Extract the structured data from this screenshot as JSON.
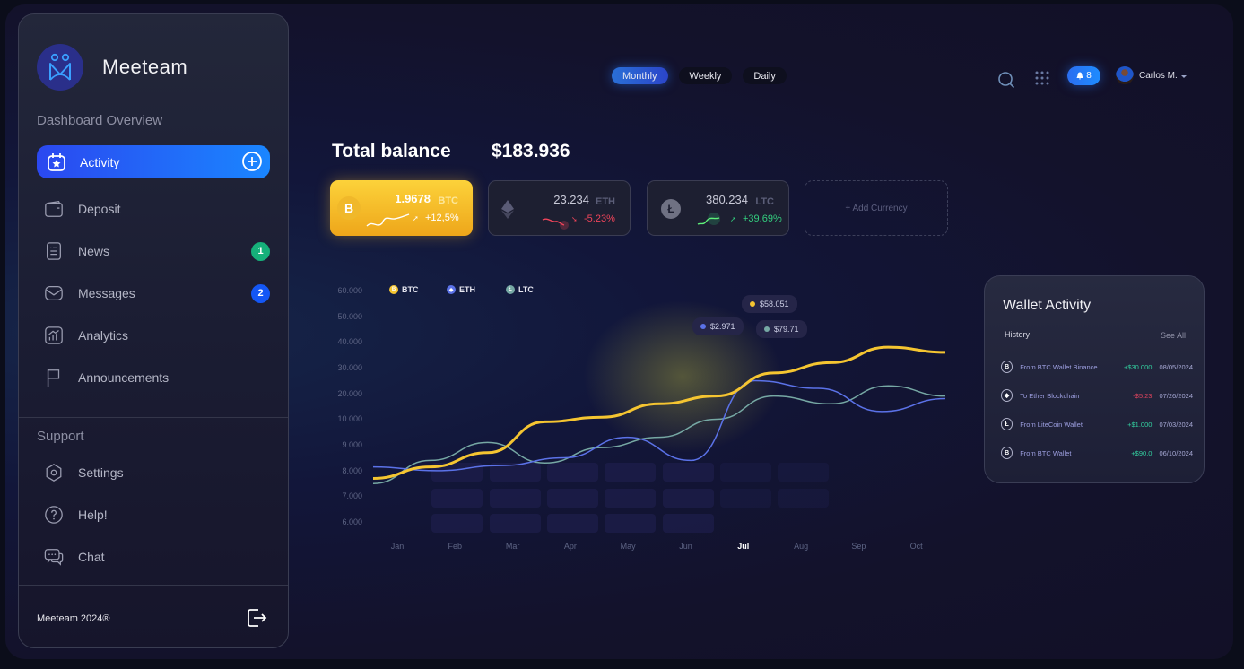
{
  "brand": {
    "name": "Meeteam",
    "logo_icon": "people-connect-icon"
  },
  "sidebar": {
    "section_title": "Dashboard Overview",
    "active_item": {
      "label": "Activity",
      "icon": "calendar-star-icon",
      "action_icon": "plus-circle-icon"
    },
    "items": [
      {
        "label": "Deposit",
        "icon": "wallet-icon",
        "badge": null
      },
      {
        "label": "News",
        "icon": "document-list-icon",
        "badge": "1",
        "badge_color": "#16b07a"
      },
      {
        "label": "Messages",
        "icon": "envelope-icon",
        "badge": "2",
        "badge_color": "#1457f5"
      },
      {
        "label": "Analytics",
        "icon": "bar-chart-icon",
        "badge": null
      },
      {
        "label": "Announcements",
        "icon": "flag-icon",
        "badge": null
      }
    ],
    "support_title": "Support",
    "support_items": [
      {
        "label": "Settings",
        "icon": "gear-icon"
      },
      {
        "label": "Help!",
        "icon": "question-circle-icon"
      },
      {
        "label": "Chat",
        "icon": "chat-bubbles-icon"
      }
    ],
    "footer": "Meeteam 2024®",
    "logout_icon": "logout-icon"
  },
  "header": {
    "tabs": [
      {
        "label": "Monthly",
        "active": true
      },
      {
        "label": "Weekly",
        "active": false
      },
      {
        "label": "Daily",
        "active": false
      }
    ],
    "notifications": "8",
    "user": "Carlos M."
  },
  "balance": {
    "label": "Total balance",
    "value": "$183.936"
  },
  "cards": [
    {
      "amount": "1.9678",
      "symbol": "BTC",
      "change": "+12,5%",
      "trend": "up"
    },
    {
      "amount": "23.234",
      "symbol": "ETH",
      "change": "-5.23%",
      "trend": "down"
    },
    {
      "amount": "380.234",
      "symbol": "LTC",
      "change": "+39.69%",
      "trend": "up"
    }
  ],
  "add_currency": "+ Add Currency",
  "colors": {
    "btc": "#f5c531",
    "eth": "#5b72e8",
    "ltc": "#76a8a4",
    "positive": "#33d07f",
    "negative": "#f0445a",
    "accent": "#1a86ff"
  },
  "chart_data": {
    "type": "line",
    "title": "",
    "xlabel": "",
    "ylabel": "",
    "categories": [
      "Jan",
      "Feb",
      "Mar",
      "Apr",
      "May",
      "Jun",
      "Jul",
      "Aug",
      "Sep",
      "Oct"
    ],
    "highlight_category": "Jul",
    "y_ticks": [
      "60.000",
      "50.000",
      "40.000",
      "30.000",
      "20.000",
      "10.000",
      "9.000",
      "8.000",
      "7.000",
      "6.000"
    ],
    "legend": [
      "BTC",
      "ETH",
      "LTC"
    ],
    "legend_position": "top-left",
    "series": [
      {
        "name": "BTC",
        "color": "#f5c531",
        "values": [
          7.7,
          8.15,
          8.7,
          9.9,
          10.8,
          16,
          19,
          28,
          32,
          38,
          36
        ]
      },
      {
        "name": "ETH",
        "color": "#5b72e8",
        "values": [
          8.15,
          8.0,
          8.2,
          8.5,
          9.3,
          8.4,
          25,
          22,
          13,
          18
        ]
      },
      {
        "name": "LTC",
        "color": "#76a8a4",
        "values": [
          7.5,
          8.4,
          9.1,
          8.3,
          8.9,
          9.3,
          10,
          19,
          16,
          23,
          19
        ]
      }
    ],
    "tooltips": [
      {
        "series": "BTC",
        "label": "$58.051",
        "color": "#f5c531"
      },
      {
        "series": "ETH",
        "label": "$2.971",
        "color": "#5b72e8"
      },
      {
        "series": "LTC",
        "label": "$79.71",
        "color": "#76a8a4"
      }
    ]
  },
  "wallet": {
    "title": "Wallet Activity",
    "history_label": "History",
    "see_all": "See All",
    "rows": [
      {
        "coin": "B",
        "desc": "From BTC Wallet Binance",
        "amount": "+$30.000",
        "date": "08/05/2024",
        "positive": true
      },
      {
        "coin": "E",
        "desc": "To Ether Blockchain",
        "amount": "-$5.23",
        "date": "07/26/2024",
        "positive": false
      },
      {
        "coin": "L",
        "desc": "From LiteCoin Wallet",
        "amount": "+$1.000",
        "date": "07/03/2024",
        "positive": true
      },
      {
        "coin": "B",
        "desc": "From BTC Wallet",
        "amount": "+$90.0",
        "date": "06/10/2024",
        "positive": true
      }
    ]
  }
}
